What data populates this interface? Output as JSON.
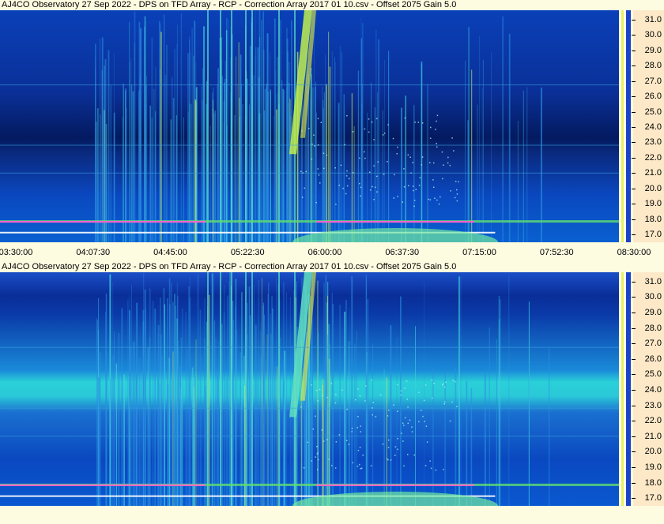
{
  "chart_data": [
    {
      "type": "heatmap",
      "title": "AJ4CO Observatory 27 Sep 2022  -  DPS on TFD Array  -  RCP  -  Correction Array 2017 01 10.csv  -  Offset 2075  Gain 5.0",
      "xlabel": "",
      "ylabel": "",
      "x_ticks": [
        "03:30:00",
        "04:07:30",
        "04:45:00",
        "05:22:30",
        "06:00:00",
        "06:37:30",
        "07:15:00",
        "07:52:30",
        "08:30:00"
      ],
      "y_ticks": [
        31.0,
        30.0,
        29.0,
        28.0,
        27.0,
        26.0,
        25.0,
        24.0,
        23.0,
        22.0,
        21.0,
        20.0,
        19.0,
        18.0,
        17.0
      ],
      "ylim": [
        16.5,
        31.6
      ],
      "colormap": [
        "#001a70",
        "#0038b0",
        "#0a5fd6",
        "#1aa0e6",
        "#30d4d0",
        "#8cf07a",
        "#f0f03c",
        "#ff4fd0",
        "#ffffff"
      ]
    },
    {
      "type": "heatmap",
      "title": "AJ4CO Observatory 27 Sep 2022  -  DPS on TFD Array  -  RCP  -  Correction Array 2017 01 10.csv  -  Offset 2075  Gain 5.0",
      "xlabel": "",
      "ylabel": "",
      "x_ticks": [],
      "y_ticks": [
        31.0,
        30.0,
        29.0,
        28.0,
        27.0,
        26.0,
        25.0,
        24.0,
        23.0,
        22.0,
        21.0,
        20.0,
        19.0,
        18.0,
        17.0
      ],
      "ylim": [
        16.5,
        31.6
      ],
      "colormap": [
        "#001a70",
        "#0038b0",
        "#0a5fd6",
        "#1aa0e6",
        "#30d4d0",
        "#8cf07a",
        "#f0f03c",
        "#ff4fd0",
        "#ffffff"
      ]
    }
  ]
}
